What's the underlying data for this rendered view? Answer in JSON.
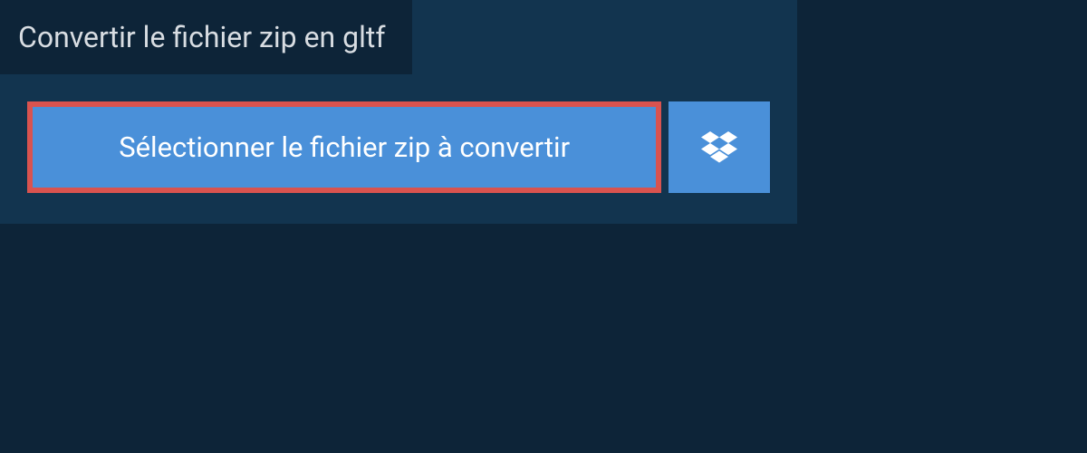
{
  "header": {
    "title": "Convertir le fichier zip en gltf"
  },
  "actions": {
    "select_file_label": "Sélectionner le fichier zip à convertir"
  },
  "colors": {
    "background": "#0d2438",
    "panel": "#12344f",
    "button": "#4a90d9",
    "highlight_border": "#d9534f",
    "text_light": "#d8dde2"
  }
}
